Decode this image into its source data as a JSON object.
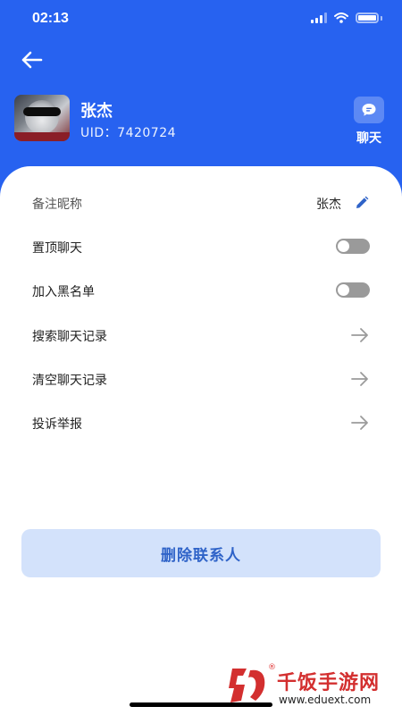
{
  "status_bar": {
    "time": "02:13"
  },
  "header": {
    "back_icon": "arrow-left-icon",
    "contact": {
      "name": "张杰",
      "uid": "UID：7420724"
    },
    "chat_button": {
      "label": "聊天",
      "icon": "chat-bubble-icon"
    }
  },
  "settings": {
    "remark": {
      "label": "备注昵称",
      "value": "张杰",
      "icon": "pencil-icon"
    },
    "pin_chat": {
      "label": "置顶聊天",
      "enabled": false
    },
    "blacklist": {
      "label": "加入黑名单",
      "enabled": false
    },
    "search_history": {
      "label": "搜索聊天记录",
      "icon": "arrow-right-icon"
    },
    "clear_history": {
      "label": "清空聊天记录",
      "icon": "arrow-right-icon"
    },
    "report": {
      "label": "投诉举报",
      "icon": "arrow-right-icon"
    }
  },
  "delete_button": {
    "label": "删除联系人"
  },
  "watermark": {
    "title": "千饭手游网",
    "url": "www.eduext.com",
    "reg": "®"
  },
  "colors": {
    "header_blue": "#2762f0",
    "delete_bg": "#d3e2fb",
    "delete_text": "#2f63c8",
    "toggle_off": "#9a9a9a",
    "watermark_red": "#d32f2f"
  }
}
